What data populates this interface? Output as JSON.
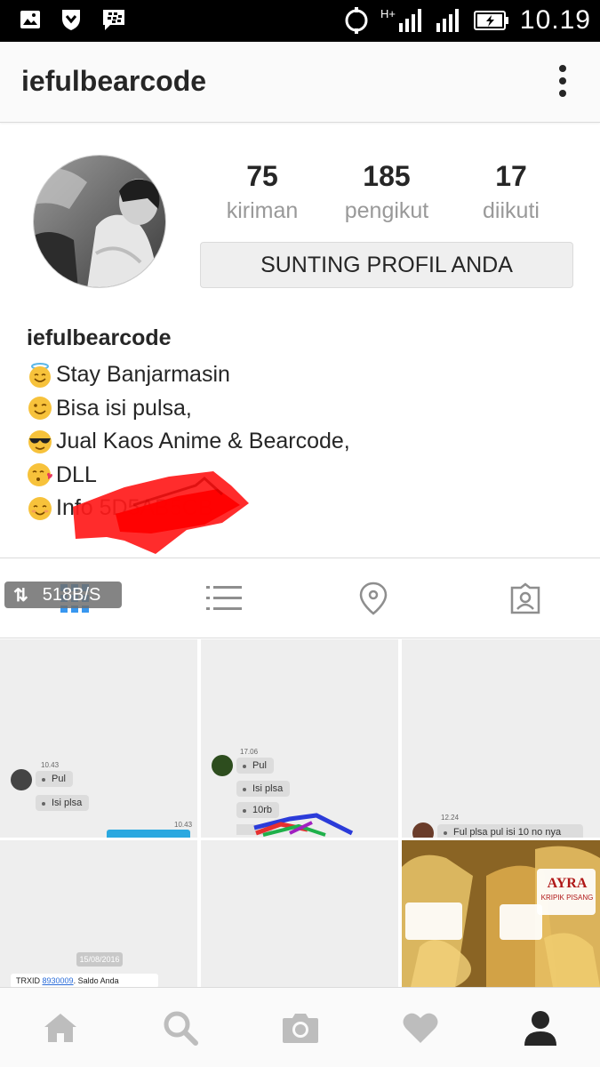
{
  "status_bar": {
    "time": "10.19",
    "network": "H+",
    "icons": [
      "gallery-icon",
      "shield-icon",
      "blackberry-messenger-icon",
      "sync-icon",
      "signal-icon",
      "signal-icon",
      "battery-charging-icon"
    ]
  },
  "app_bar": {
    "title": "iefulbearcode",
    "menu_icon": "more-vertical-icon"
  },
  "profile": {
    "stats": [
      {
        "value": "75",
        "label": "kiriman"
      },
      {
        "value": "185",
        "label": "pengikut"
      },
      {
        "value": "17",
        "label": "diikuti"
      }
    ],
    "edit_button": "SUNTING PROFIL ANDA",
    "username": "iefulbearcode",
    "bio_lines": [
      {
        "emoji": "smiling-face-with-halo",
        "text": "Stay Banjarmasin"
      },
      {
        "emoji": "winking-face",
        "text": "Bisa isi pulsa,"
      },
      {
        "emoji": "smiling-face-with-sunglasses",
        "text": "Jual Kaos Anime & Bearcode,"
      },
      {
        "emoji": "face-blowing-kiss",
        "text": "DLL"
      },
      {
        "emoji": "smiling-face",
        "text": "Info 5D5AB5CB"
      }
    ]
  },
  "tabs": {
    "speed_overlay": "518B/S",
    "items": [
      "grid-icon",
      "list-icon",
      "location-pin-icon",
      "tagged-photos-icon"
    ]
  },
  "grid": {
    "cell1": {
      "time1": "10.43",
      "msgs": [
        "Pul",
        "Isi plsa"
      ],
      "time2": "10.43"
    },
    "cell2": {
      "time": "17.06",
      "msgs": [
        "Pul",
        "Isi plsa",
        "10rb"
      ]
    },
    "cell3": {
      "time": "12.24",
      "msg": "Ful plsa pul isi 10 no nya"
    },
    "cell4": {
      "date": "15/08/2016",
      "trx_label": "TRXID",
      "trx_id": "8930009",
      "trx_rest": ". Saldo Anda"
    },
    "cell6": {
      "brand": "AYRA",
      "product": "KRIPIK PISANG"
    }
  },
  "colors": {
    "accent": "#3897f0",
    "text": "#262626",
    "muted": "#999999",
    "redaction": "#ff0000"
  },
  "bottom_nav": [
    "home-icon",
    "search-icon",
    "camera-icon",
    "heart-icon",
    "profile-icon"
  ]
}
